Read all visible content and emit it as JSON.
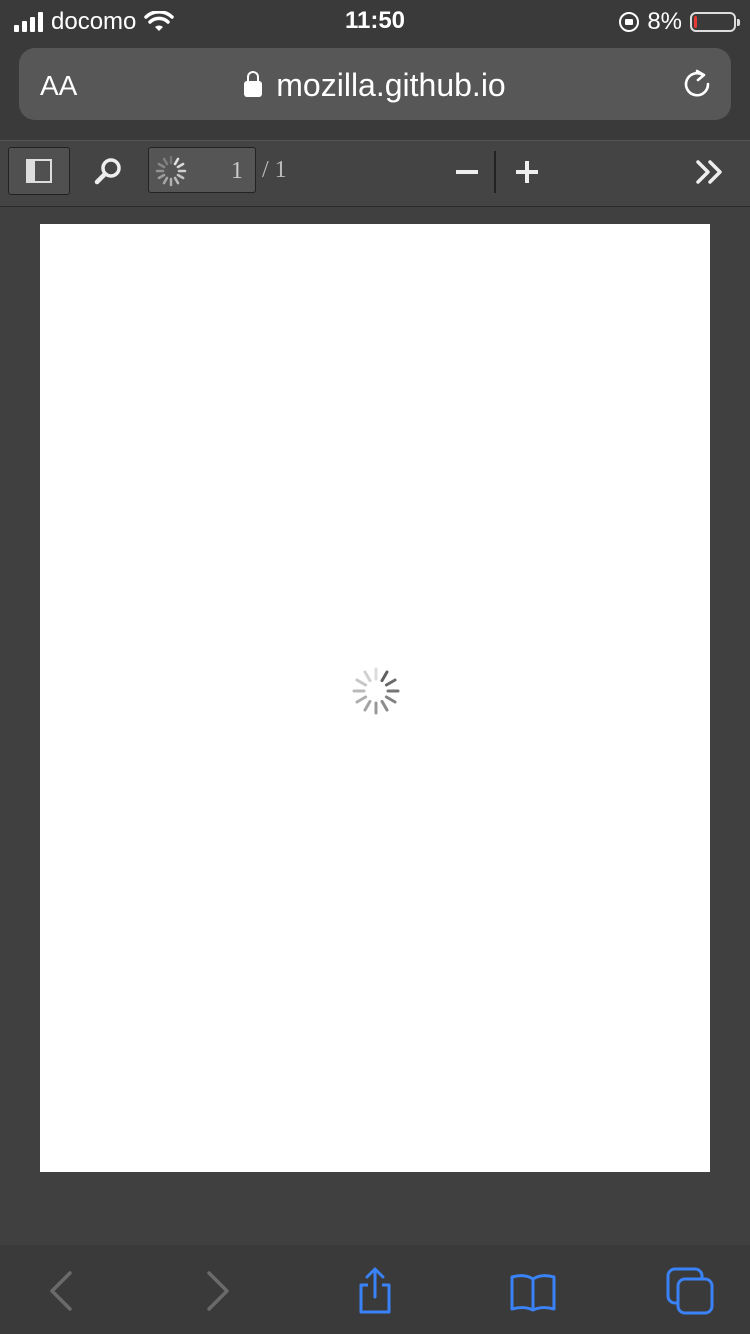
{
  "status_bar": {
    "carrier": "docomo",
    "time": "11:50",
    "battery_percent_text": "8%",
    "battery_level": 0.08,
    "battery_color": "#e53935"
  },
  "address_bar": {
    "text_size_label": "AA",
    "url": "mozilla.github.io",
    "icons": [
      "lock-icon",
      "reload-icon"
    ]
  },
  "pdf_toolbar": {
    "page_number": "1",
    "page_count": "/ 1",
    "icons": [
      "sidebar-toggle-icon",
      "search-icon",
      "loading-spinner-icon",
      "zoom-out-icon",
      "zoom-in-icon",
      "double-chevron-right-icon"
    ]
  },
  "viewer": {
    "page_background": "#ffffff",
    "icons": [
      "loading-spinner-icon"
    ]
  },
  "bottom_bar": {
    "icons": [
      "back-arrow-icon",
      "forward-arrow-icon",
      "share-icon",
      "bookmarks-icon",
      "tabs-icon"
    ],
    "accent_color": "#3a82f7"
  }
}
